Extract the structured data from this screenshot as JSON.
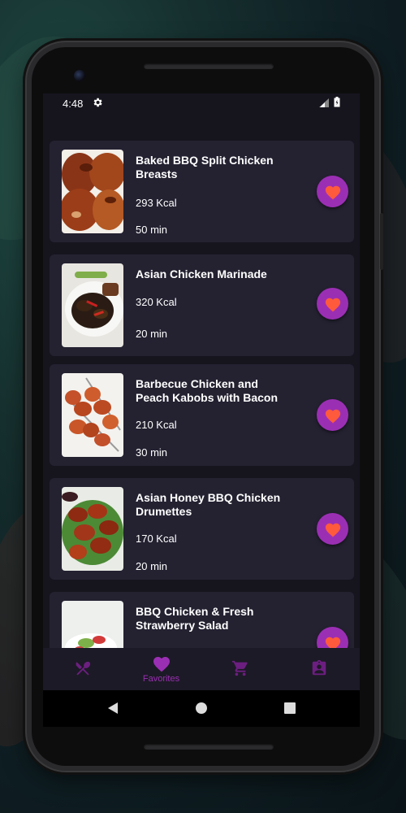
{
  "status_bar": {
    "time": "4:48"
  },
  "recipes": [
    {
      "title": "Baked BBQ Split Chicken Breasts",
      "kcal": "293 Kcal",
      "time": "50 min"
    },
    {
      "title": "Asian Chicken Marinade",
      "kcal": "320 Kcal",
      "time": "20 min"
    },
    {
      "title": "Barbecue Chicken and Peach Kabobs with Bacon",
      "kcal": "210 Kcal",
      "time": "30 min"
    },
    {
      "title": "Asian Honey BBQ Chicken Drumettes",
      "kcal": "170 Kcal",
      "time": "20 min"
    },
    {
      "title": "BBQ Chicken & Fresh Strawberry Salad",
      "kcal": "",
      "time": ""
    }
  ],
  "bottom_nav": {
    "items": [
      {
        "icon": "restaurant-icon",
        "label": ""
      },
      {
        "icon": "heart-icon",
        "label": "Favorites"
      },
      {
        "icon": "cart-icon",
        "label": ""
      },
      {
        "icon": "contact-icon",
        "label": ""
      }
    ],
    "active_index": 1
  },
  "colors": {
    "accent": "#9b2fb4",
    "heart_fill": "#ff5a3c",
    "background": "#16151e",
    "card": "#242231"
  }
}
